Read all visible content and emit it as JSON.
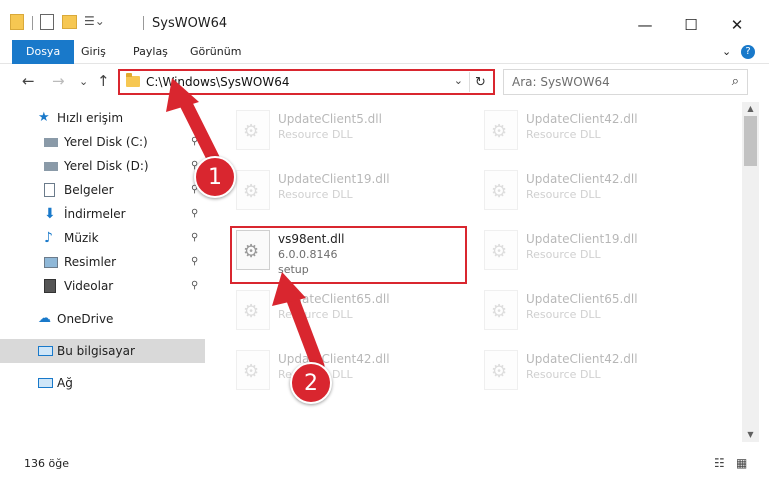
{
  "window": {
    "title": "SysWOW64",
    "minimize_glyph": "—",
    "maximize_glyph": "☐",
    "close_glyph": "✕"
  },
  "ribbon": {
    "tabs": [
      "Dosya",
      "Giriş",
      "Paylaş",
      "Görünüm"
    ],
    "expand_glyph": "⌄",
    "help_glyph": "?"
  },
  "address": {
    "path": "C:\\Windows\\SysWOW64",
    "dropdown_glyph": "⌄",
    "refresh_glyph": "↻"
  },
  "nav_buttons": {
    "back": "←",
    "forward": "→",
    "recent": "⌄",
    "up": "↑"
  },
  "search": {
    "placeholder": "Ara: SysWOW64",
    "icon_glyph": "⌕"
  },
  "nav_pane": {
    "quick_access": "Hızlı erişim",
    "items": [
      {
        "label": "Yerel Disk (C:)",
        "icon": "drive-icon",
        "pinned": true
      },
      {
        "label": "Yerel Disk (D:)",
        "icon": "drive-icon",
        "pinned": true
      },
      {
        "label": "Belgeler",
        "icon": "documents-icon",
        "pinned": true
      },
      {
        "label": "İndirmeler",
        "icon": "downloads-icon",
        "pinned": true
      },
      {
        "label": "Müzik",
        "icon": "music-icon",
        "pinned": true
      },
      {
        "label": "Resimler",
        "icon": "pictures-icon",
        "pinned": true
      },
      {
        "label": "Videolar",
        "icon": "videos-icon",
        "pinned": true
      }
    ],
    "onedrive": "OneDrive",
    "this_pc": "Bu bilgisayar",
    "network": "Ağ",
    "pin_glyph": "📌"
  },
  "files": [
    {
      "name": "UpdateClient5.dll",
      "type": "Resource DLL",
      "faded": true
    },
    {
      "name": "UpdateClient42.dll",
      "type": "Resource DLL",
      "faded": true
    },
    {
      "name": "UpdateClient19.dll",
      "type": "Resource DLL",
      "faded": true
    },
    {
      "name": "UpdateClient42.dll",
      "type": "Resource DLL",
      "faded": true
    },
    {
      "name": "vs98ent.dll",
      "version": "6.0.0.8146",
      "type": "setup",
      "faded": false
    },
    {
      "name": "UpdateClient19.dll",
      "type": "Resource DLL",
      "faded": true
    },
    {
      "name": "UpdateClient65.dll",
      "type": "Resource DLL",
      "faded": true
    },
    {
      "name": "UpdateClient65.dll",
      "type": "Resource DLL",
      "faded": true
    },
    {
      "name": "UpdateClient42.dll",
      "type": "Resource DLL",
      "faded": true
    },
    {
      "name": "UpdateClient42.dll",
      "type": "Resource DLL",
      "faded": true
    }
  ],
  "status": {
    "count": "136 öğe"
  },
  "annotations": [
    "1",
    "2"
  ],
  "colors": {
    "accent": "#1979ca",
    "highlight": "#d9262f",
    "selected": "#d9d9d9"
  }
}
